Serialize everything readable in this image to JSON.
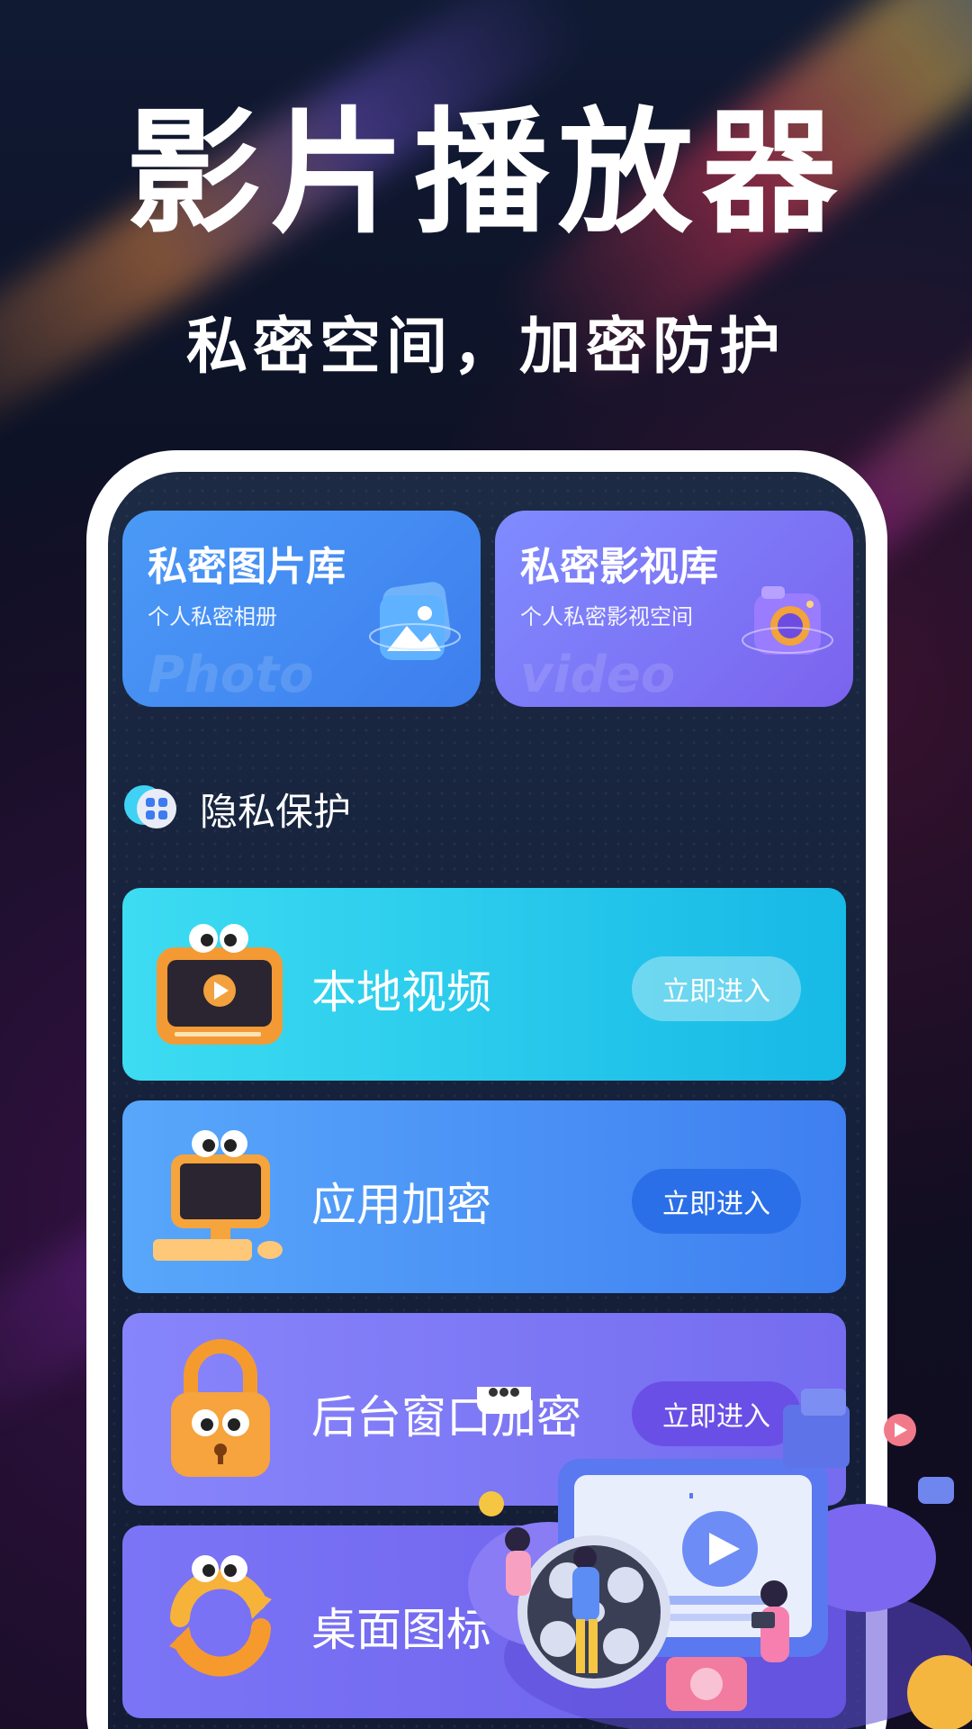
{
  "promo": {
    "headline": "影片播放器",
    "subline": "私密空间，加密防护"
  },
  "cards": [
    {
      "title": "私密图片库",
      "subtitle": "个人私密相册",
      "watermark": "Photo",
      "icon": "photo-gallery-icon"
    },
    {
      "title": "私密影视库",
      "subtitle": "个人私密影视空间",
      "watermark": "video",
      "icon": "camera-icon"
    }
  ],
  "section": {
    "title": "隐私保护",
    "icon": "apps-grid-icon"
  },
  "features": [
    {
      "label": "本地视频",
      "button": "立即进入",
      "icon": "video-player-icon"
    },
    {
      "label": "应用加密",
      "button": "立即进入",
      "icon": "computer-icon"
    },
    {
      "label": "后台窗口加密",
      "button": "立即进入",
      "icon": "padlock-icon"
    },
    {
      "label": "桌面图标",
      "icon": "refresh-arrows-icon"
    }
  ],
  "colors": {
    "feature_1": "#17b9e6",
    "feature_2": "#3f7ff0",
    "feature_3": "#756cef",
    "feature_4": "#6d5feb"
  }
}
